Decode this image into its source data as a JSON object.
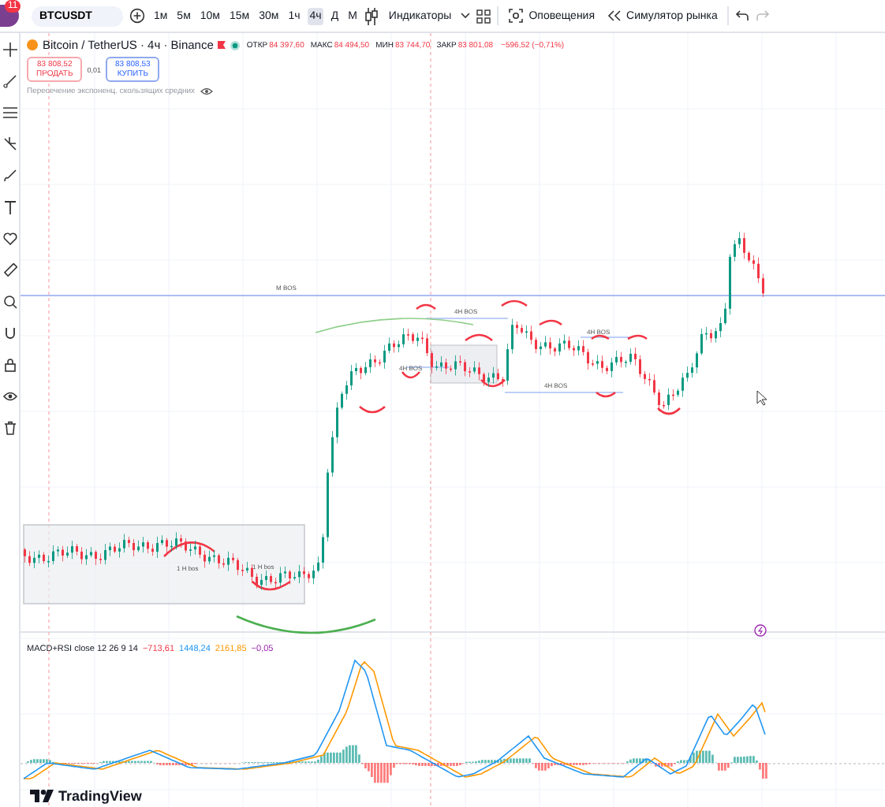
{
  "toolbar": {
    "badge": "11",
    "symbol": "BTCUSDT",
    "intervals": [
      {
        "label": "1м",
        "selected": false
      },
      {
        "label": "5м",
        "selected": false
      },
      {
        "label": "10м",
        "selected": false
      },
      {
        "label": "15м",
        "selected": false
      },
      {
        "label": "30м",
        "selected": false
      },
      {
        "label": "1ч",
        "selected": false
      },
      {
        "label": "4ч",
        "selected": true
      },
      {
        "label": "Д",
        "selected": false
      },
      {
        "label": "М",
        "selected": false
      }
    ],
    "indicators": "Индикаторы",
    "alerts": "Оповещения",
    "replay": "Симулятор рынка"
  },
  "legend": {
    "title": "Bitcoin / TetherUS · 4ч · Binance",
    "ohlc": [
      {
        "label": "ОТКР",
        "value": "84 397,60"
      },
      {
        "label": "МАКС",
        "value": "84 494,50"
      },
      {
        "label": "МИН",
        "value": "83 744,70"
      },
      {
        "label": "ЗАКР",
        "value": "83 801,08"
      }
    ],
    "change": "−596,52 (−0,71%)",
    "sell": {
      "price": "83 808,52",
      "label": "ПРОДАТЬ"
    },
    "spread": "0,01",
    "buy": {
      "price": "83 808,53",
      "label": "КУПИТЬ"
    },
    "indicator": "Пересечение экспоненц. скользящих средних"
  },
  "chart_labels": [
    "M  BOS",
    "4H BOS",
    "4H BOS",
    "4H BOS",
    "4H BOS",
    "1 H bos",
    "1 H bos"
  ],
  "macd": {
    "title": "MACD+RSI close 12 26 9 14",
    "values": [
      {
        "text": "−713,61",
        "color": "#f23645"
      },
      {
        "text": "1448,24",
        "color": "#2196f3"
      },
      {
        "text": "2161,85",
        "color": "#ff9800"
      },
      {
        "text": "−0,05",
        "color": "#9c27b0"
      }
    ]
  },
  "logo": "TradingView"
}
